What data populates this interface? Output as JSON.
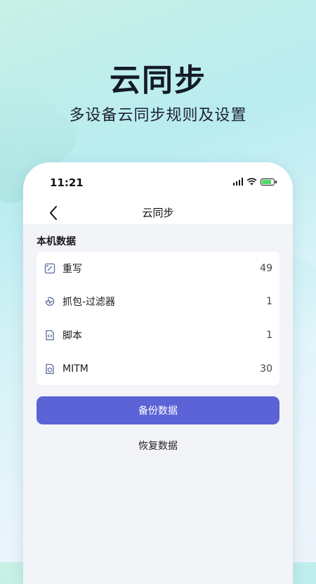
{
  "hero": {
    "title": "云同步",
    "subtitle": "多设备云同步规则及设置"
  },
  "status_bar": {
    "time": "11:21",
    "icons": [
      "cellular-signal-icon",
      "wifi-icon",
      "battery-charging-icon"
    ]
  },
  "nav": {
    "title": "云同步",
    "back_icon": "chevron-left-icon"
  },
  "section": {
    "title": "本机数据"
  },
  "items": [
    {
      "label": "重写",
      "count": "49",
      "icon": "rewrite-icon"
    },
    {
      "label": "抓包-过滤器",
      "count": "1",
      "icon": "filter-icon"
    },
    {
      "label": "脚本",
      "count": "1",
      "icon": "script-file-icon"
    },
    {
      "label": "MITM",
      "count": "30",
      "icon": "shield-file-icon"
    }
  ],
  "actions": {
    "backup_label": "备份数据",
    "restore_label": "恢复数据"
  },
  "colors": {
    "accent": "#5b63d6",
    "icon": "#5a6aa0"
  }
}
